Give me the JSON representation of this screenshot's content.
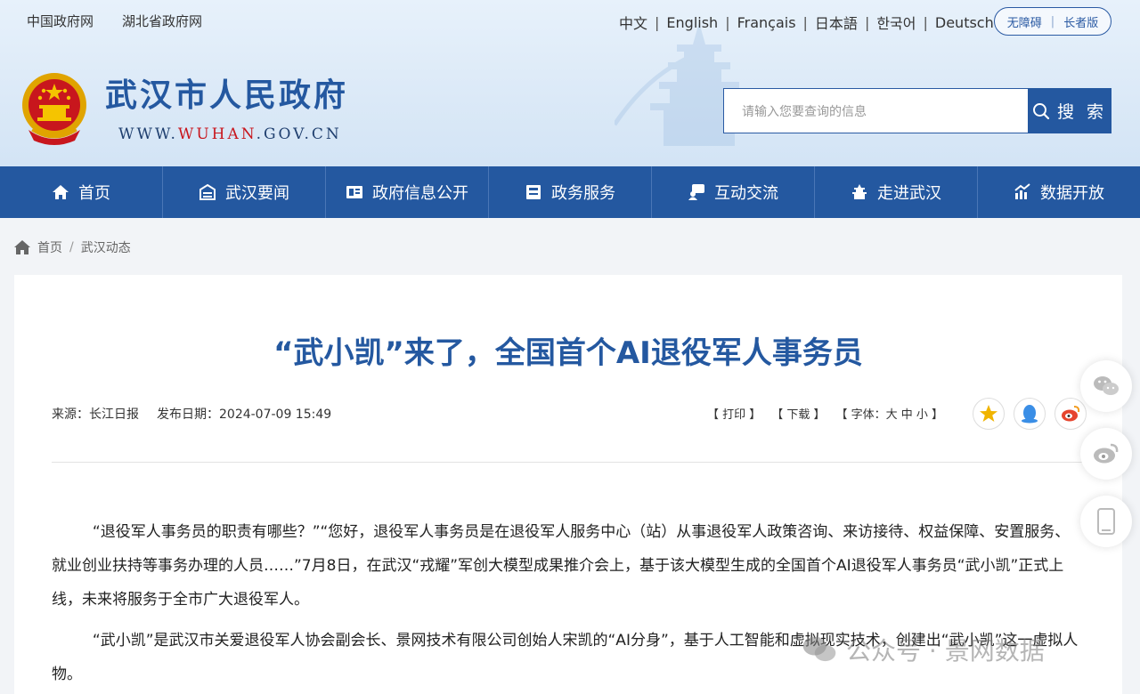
{
  "top_links": [
    "中国政府网",
    "湖北省政府网"
  ],
  "languages": [
    "中文",
    "English",
    "Français",
    "日本語",
    "한국어",
    "Deutsch"
  ],
  "accessibility": {
    "barrier_free": "无障碍",
    "elder": "长者版"
  },
  "site": {
    "title": "武汉市人民政府",
    "url_prefix": "WWW.",
    "url_highlight": "WUHAN",
    "url_suffix": ".GOV.CN"
  },
  "search": {
    "placeholder": "请输入您要查询的信息",
    "button": "搜 索"
  },
  "nav": [
    {
      "label": "首页",
      "icon": "home-icon"
    },
    {
      "label": "武汉要闻",
      "icon": "news-icon"
    },
    {
      "label": "政府信息公开",
      "icon": "info-disclosure-icon"
    },
    {
      "label": "政务服务",
      "icon": "service-icon"
    },
    {
      "label": "互动交流",
      "icon": "interaction-icon"
    },
    {
      "label": "走进武汉",
      "icon": "landmark-icon"
    },
    {
      "label": "数据开放",
      "icon": "data-chart-icon"
    }
  ],
  "breadcrumb": [
    "首页",
    "武汉动态"
  ],
  "article": {
    "title": "“武小凯”来了，全国首个AI退役军人事务员",
    "source": "来源：长江日报",
    "date": "发布日期：2024-07-09 15:49",
    "print": "【 打印 】",
    "download": "【 下载 】",
    "font_size": "【 字体：大  中  小 】",
    "paragraphs": [
      "“退役军人事务员的职责有哪些？”“您好，退役军人事务员是在退役军人服务中心（站）从事退役军人政策咨询、来访接待、权益保障、安置服务、就业创业扶持等事务办理的人员……”7月8日，在武汉“戎耀”军创大模型成果推介会上，基于该大模型生成的全国首个AI退役军人事务员“武小凯”正式上线，未来将服务于全市广大退役军人。",
      "“武小凯”是武汉市关爱退役军人协会副会长、景网技术有限公司创始人宋凯的“AI分身”，基于人工智能和虚拟现实技术，创建出“武小凯”这一虚拟人物。"
    ]
  },
  "watermark": "公众号 · 景网数据",
  "colors": {
    "brand_blue": "#2458a0",
    "emblem_red": "#c8161d",
    "gold": "#f0b400"
  }
}
